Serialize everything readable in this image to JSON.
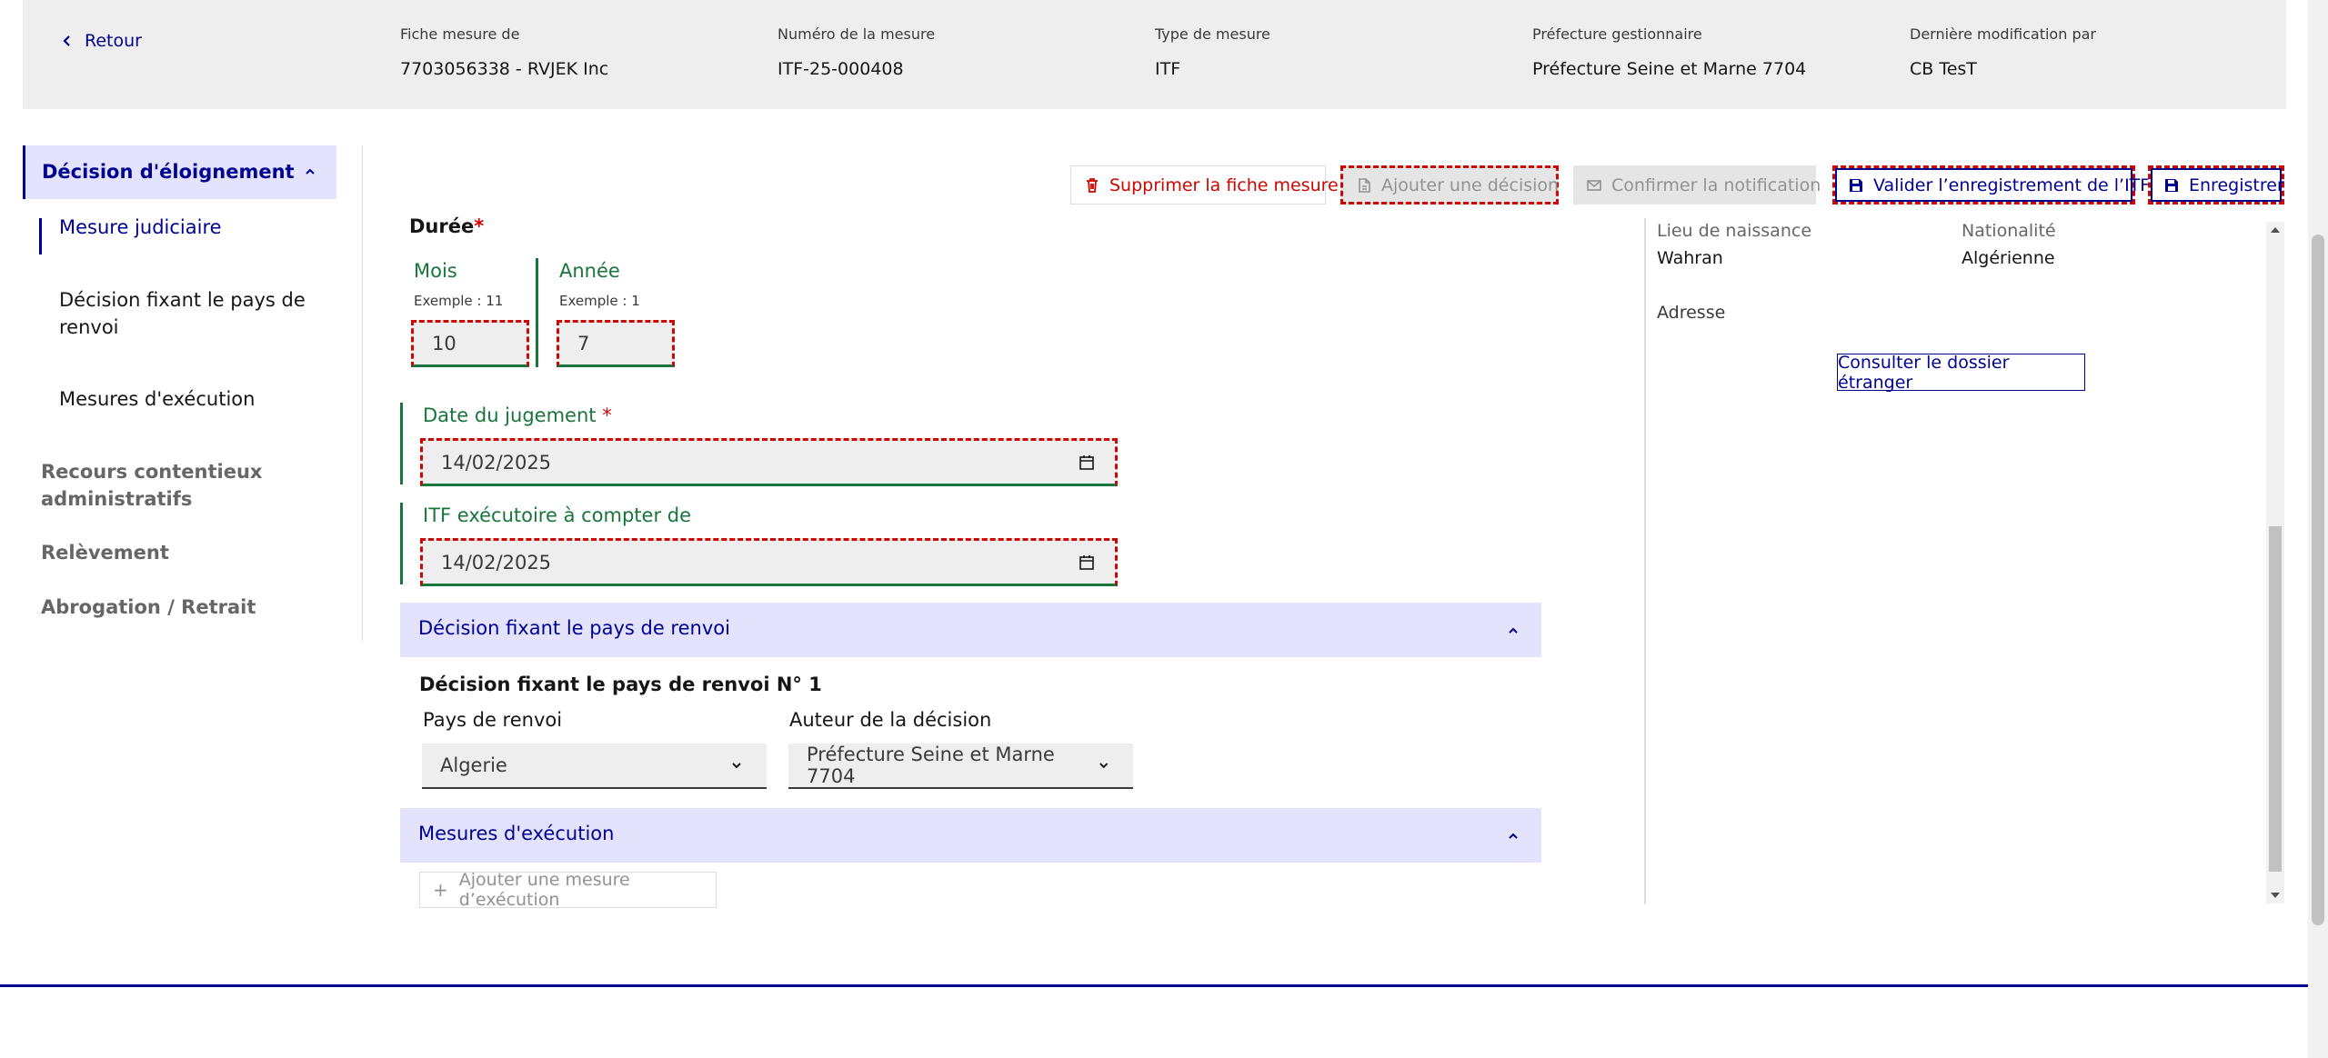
{
  "header": {
    "back_label": "Retour",
    "fields": [
      {
        "label": "Fiche mesure de",
        "value": "7703056338 - RVJEK Inc"
      },
      {
        "label": "Numéro de la mesure",
        "value": "ITF-25-000408"
      },
      {
        "label": "Type de mesure",
        "value": "ITF"
      },
      {
        "label": "Préfecture gestionnaire",
        "value": "Préfecture Seine et Marne 7704"
      },
      {
        "label": "Dernière modification par",
        "value": "CB TesT"
      }
    ]
  },
  "sidebar": {
    "section_title": "Décision d'éloignement",
    "items": [
      {
        "label": "Mesure judiciaire"
      },
      {
        "label": "Décision fixant le pays de renvoi"
      },
      {
        "label": "Mesures d'exécution"
      }
    ],
    "sections": [
      {
        "label": "Recours contentieux administratifs"
      },
      {
        "label": "Relèvement"
      },
      {
        "label": "Abrogation / Retrait"
      }
    ]
  },
  "toolbar": {
    "delete_label": "Supprimer la fiche mesure",
    "add_decision_label": "Ajouter une décision",
    "confirm_notification_label": "Confirmer la notification",
    "validate_label": "Valider l’enregistrement de l’ITF",
    "save_label": "Enregistrer"
  },
  "form": {
    "duration_label": "Durée",
    "required_mark": "*",
    "months": {
      "label": "Mois",
      "hint": "Exemple : 11",
      "value": "10"
    },
    "years": {
      "label": "Année",
      "hint": "Exemple : 1",
      "value": "7"
    },
    "judgment_date": {
      "label": "Date du jugement",
      "value": "14/02/2025"
    },
    "enforceable_from": {
      "label": "ITF exécutoire à compter de",
      "value": "14/02/2025"
    }
  },
  "country_section": {
    "title": "Décision fixant le pays de renvoi",
    "subtitle": "Décision fixant le pays de renvoi N° 1",
    "country": {
      "label": "Pays de renvoi",
      "value": "Algerie"
    },
    "author": {
      "label": "Auteur de la décision",
      "value": "Préfecture Seine et Marne 7704"
    }
  },
  "execution_section": {
    "title": "Mesures d'exécution",
    "add_label": "Ajouter une mesure d’exécution"
  },
  "person_panel": {
    "birthplace_label": "Lieu de naissance",
    "birthplace": "Wahran",
    "nationality_label": "Nationalité",
    "nationality": "Algérienne",
    "address_label": "Adresse",
    "dossier_button": "Consulter le dossier étranger"
  },
  "colors": {
    "primary": "#000091",
    "error": "#ce0500",
    "success": "#18753c",
    "accordion_bg": "#e3e3fd"
  }
}
